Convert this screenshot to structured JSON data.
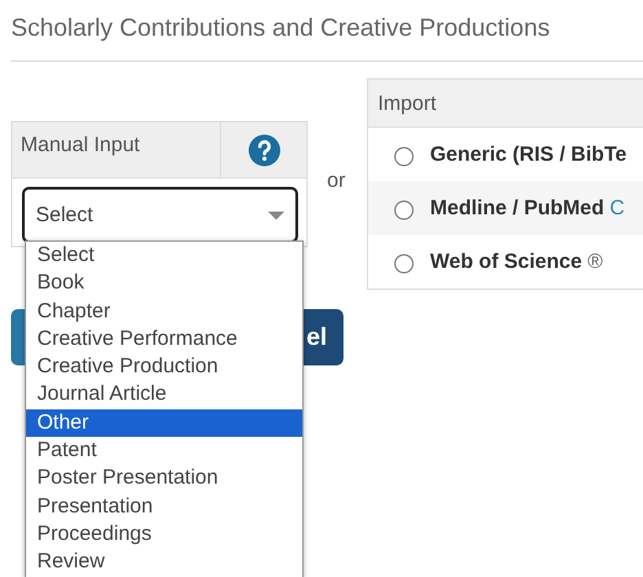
{
  "title": "Scholarly Contributions and Creative Productions",
  "manual_input": {
    "header": "Manual Input",
    "select": {
      "value": "Select",
      "expanded": true
    },
    "options": [
      {
        "label": "Select",
        "selected": false
      },
      {
        "label": "Book",
        "selected": false
      },
      {
        "label": "Chapter",
        "selected": false
      },
      {
        "label": "Creative Performance",
        "selected": false
      },
      {
        "label": "Creative Production",
        "selected": false
      },
      {
        "label": "Journal Article",
        "selected": false
      },
      {
        "label": "Other",
        "selected": true
      },
      {
        "label": "Patent",
        "selected": false
      },
      {
        "label": "Poster Presentation",
        "selected": false
      },
      {
        "label": "Presentation",
        "selected": false
      },
      {
        "label": "Proceedings",
        "selected": false
      },
      {
        "label": "Review",
        "selected": false
      }
    ]
  },
  "separator": "or",
  "buttons": [
    {
      "kind": "primary"
    },
    {
      "kind": "secondary",
      "label": "el"
    }
  ],
  "import": {
    "header": "Import",
    "options": [
      {
        "label": "Generic (RIS / BibTe",
        "selected": false
      },
      {
        "label": "Medline / PubMed",
        "link": "C",
        "selected": false
      },
      {
        "label": "Web of Science",
        "mark": "®",
        "selected": false
      }
    ]
  }
}
